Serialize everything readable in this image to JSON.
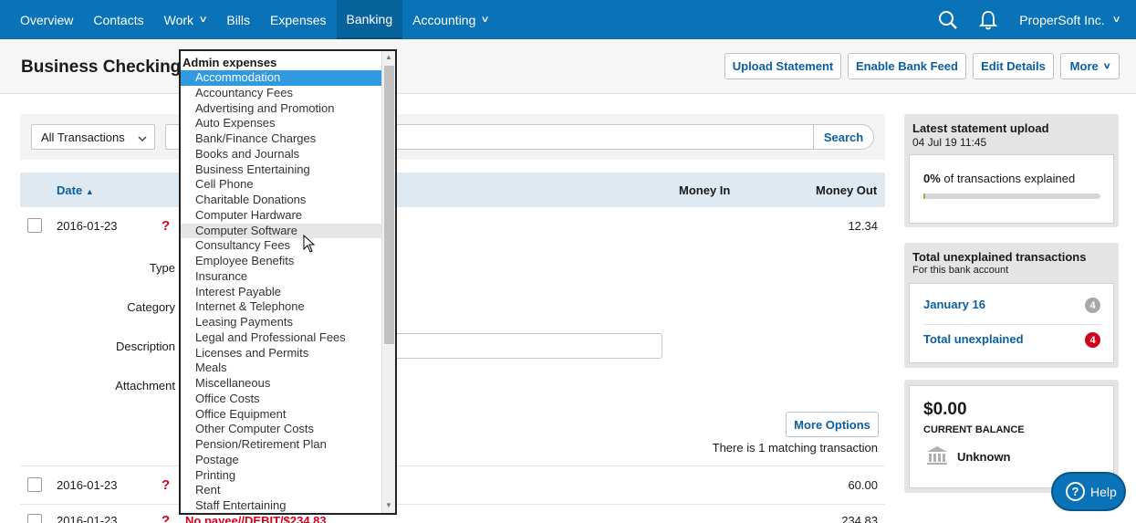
{
  "nav": {
    "items": [
      {
        "label": "Overview"
      },
      {
        "label": "Contacts"
      },
      {
        "label": "Work",
        "dropdown": true
      },
      {
        "label": "Bills"
      },
      {
        "label": "Expenses"
      },
      {
        "label": "Banking",
        "active": true
      },
      {
        "label": "Accounting",
        "dropdown": true
      }
    ],
    "company": "ProperSoft Inc."
  },
  "header": {
    "title": "Business Checking",
    "buttons": {
      "upload": "Upload Statement",
      "enable_feed": "Enable Bank Feed",
      "edit": "Edit Details",
      "more": "More"
    }
  },
  "filters": {
    "transaction_filter": "All Transactions",
    "search_label": "Search"
  },
  "table": {
    "columns": {
      "date": "Date",
      "money_in": "Money In",
      "money_out": "Money Out"
    },
    "rows": [
      {
        "date": "2016-01-23",
        "flag": "?",
        "money_out": "12.34"
      },
      {
        "date": "2016-01-23",
        "flag": "?",
        "money_out": "60.00"
      },
      {
        "date": "2016-01-23",
        "flag": "?",
        "description": "No payee//DEBIT/$234.83",
        "money_out": "234.83"
      }
    ],
    "form_labels": {
      "type": "Type",
      "category": "Category",
      "description": "Description",
      "attachment": "Attachment"
    },
    "more_options": "More Options",
    "matching_text": "There is 1 matching transaction"
  },
  "sidebar": {
    "statement": {
      "title": "Latest statement upload",
      "date": "04 Jul 19 11:45",
      "pct": "0%",
      "pct_text": "of transactions explained",
      "progress_fraction": 0.0
    },
    "unexplained": {
      "title": "Total unexplained transactions",
      "subtitle": "For this bank account",
      "items": [
        {
          "label": "January 16",
          "count": "4",
          "color": "#a8a8a8"
        },
        {
          "label": "Total unexplained",
          "count": "4",
          "color": "#d0021b"
        }
      ]
    },
    "balance": {
      "amount": "$0.00",
      "label": "CURRENT BALANCE",
      "status": "Unknown"
    }
  },
  "help": {
    "label": "Help"
  },
  "dropdown": {
    "group": "Admin expenses",
    "selected": "Accommodation",
    "hovered": "Computer Software",
    "items": [
      "Accommodation",
      "Accountancy Fees",
      "Advertising and Promotion",
      "Auto Expenses",
      "Bank/Finance Charges",
      "Books and Journals",
      "Business Entertaining",
      "Cell Phone",
      "Charitable Donations",
      "Computer Hardware",
      "Computer Software",
      "Consultancy Fees",
      "Employee Benefits",
      "Insurance",
      "Interest Payable",
      "Internet & Telephone",
      "Leasing Payments",
      "Legal and Professional Fees",
      "Licenses and Permits",
      "Meals",
      "Miscellaneous",
      "Office Costs",
      "Office Equipment",
      "Other Computer Costs",
      "Pension/Retirement Plan",
      "Postage",
      "Printing",
      "Rent",
      "Staff Entertaining"
    ]
  },
  "colors": {
    "brand": "#0a72b6",
    "link": "#0b5fa0",
    "alert": "#d0021b",
    "selected": "#2f9ae0"
  }
}
